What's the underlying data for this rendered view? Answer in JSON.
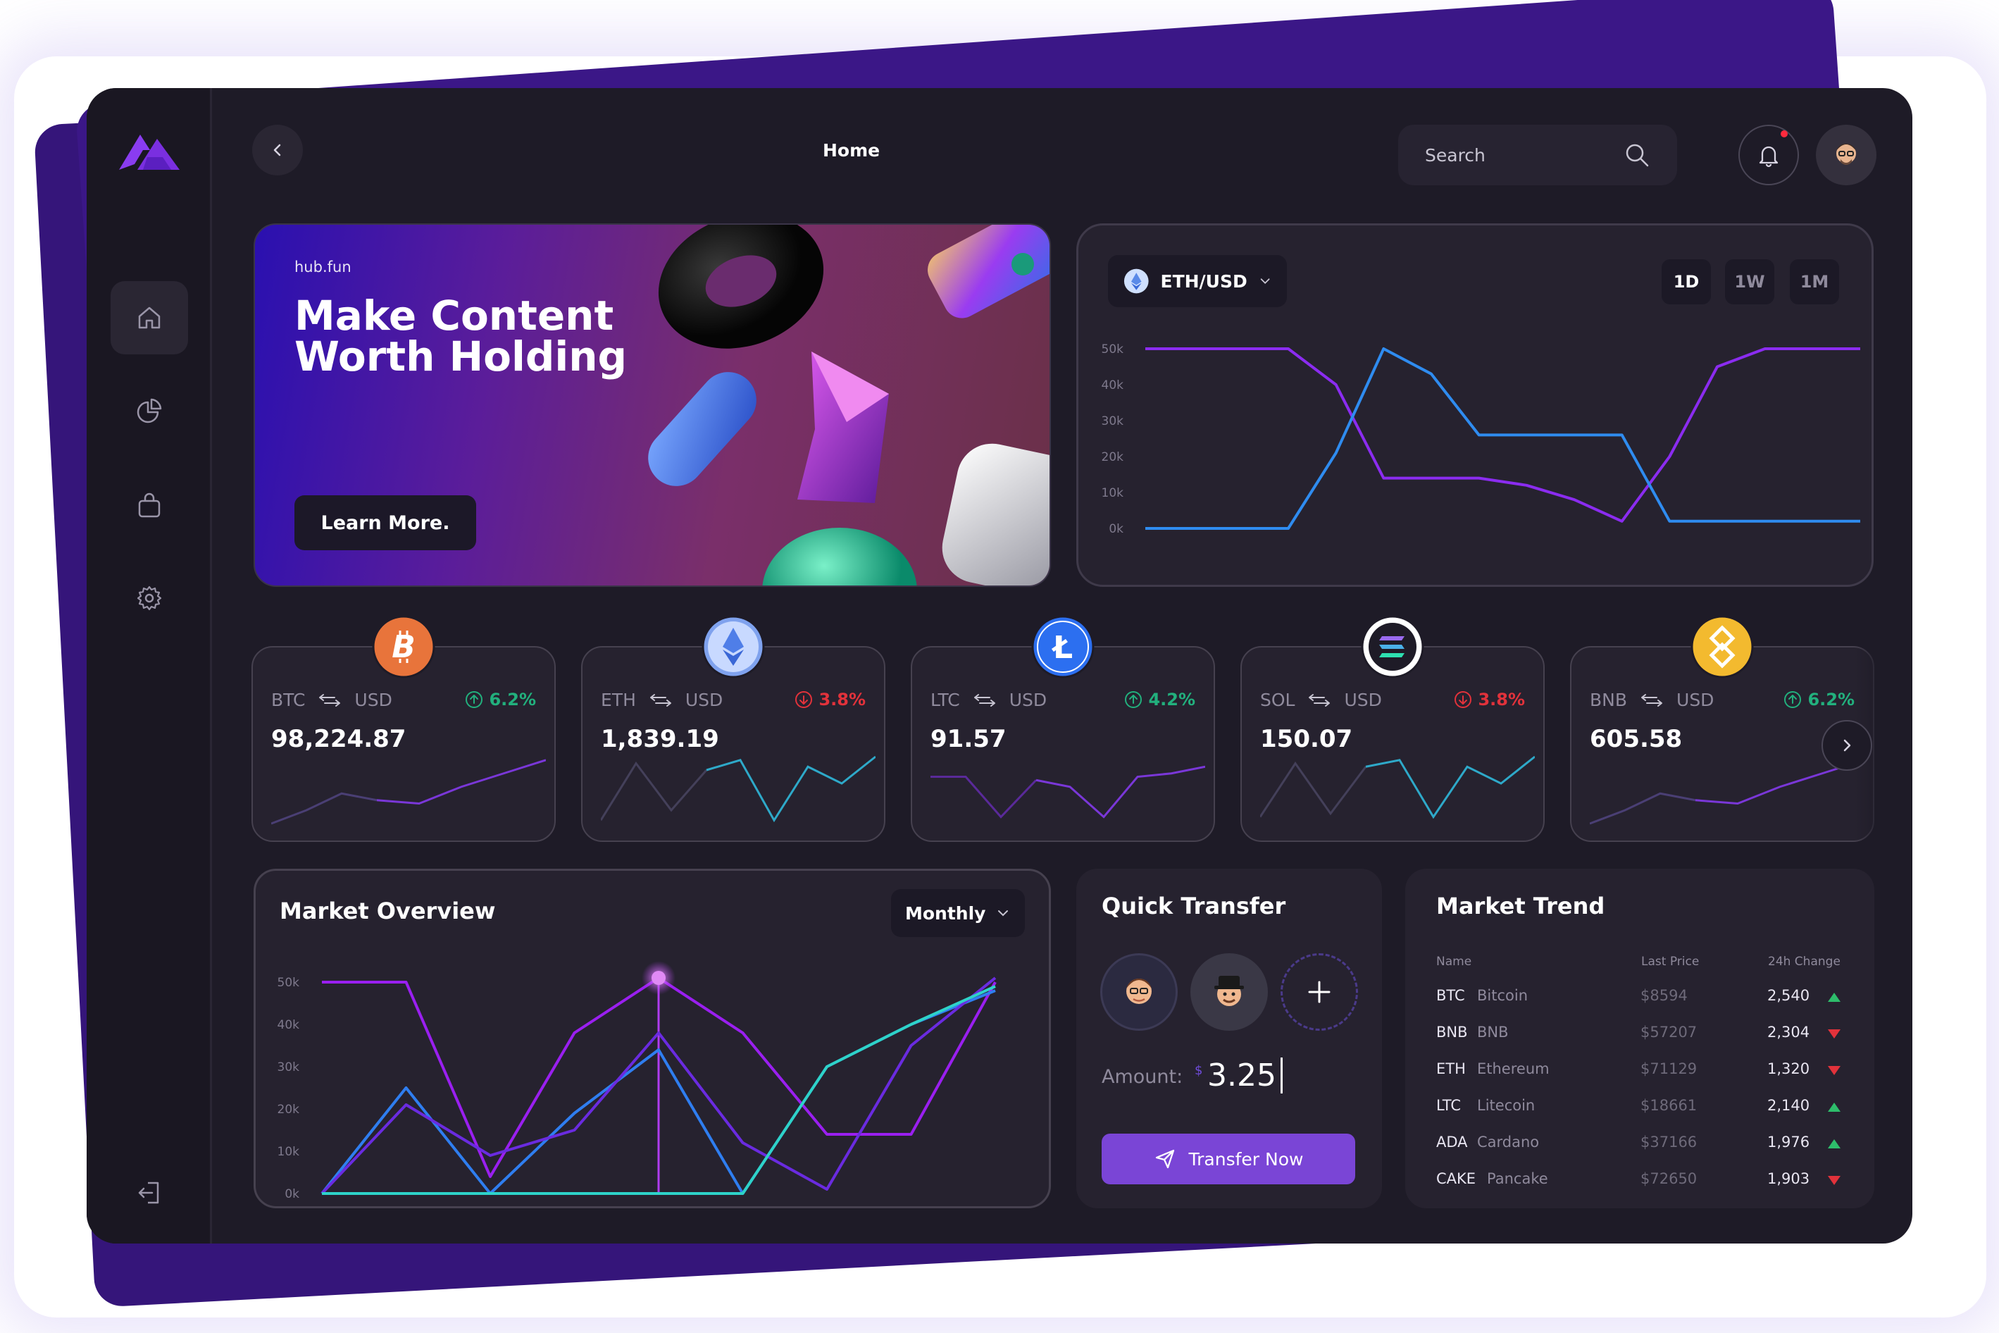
{
  "header": {
    "page_title": "Home",
    "search_placeholder": "Search"
  },
  "hero": {
    "brand": "hub.fun",
    "title": "Make Content Worth Holding",
    "cta_label": "Learn More."
  },
  "eth_chart": {
    "pair_label": "ETH/USD",
    "ranges": [
      "1D",
      "1W",
      "1M"
    ],
    "active_range": "1D"
  },
  "coins": [
    {
      "base": "BTC",
      "quote": "USD",
      "change": "6.2%",
      "direction": "up",
      "price": "98,224.87",
      "icon": "bitcoin-icon",
      "color": "#e8743b"
    },
    {
      "base": "ETH",
      "quote": "USD",
      "change": "3.8%",
      "direction": "down",
      "price": "1,839.19",
      "icon": "ethereum-icon",
      "color": "#7fa2ee"
    },
    {
      "base": "LTC",
      "quote": "USD",
      "change": "4.2%",
      "direction": "up",
      "price": "91.57",
      "icon": "litecoin-icon",
      "color": "#2c6ff0"
    },
    {
      "base": "SOL",
      "quote": "USD",
      "change": "3.8%",
      "direction": "down",
      "price": "150.07",
      "icon": "solana-icon",
      "color": "#ffffff"
    },
    {
      "base": "BNB",
      "quote": "USD",
      "change": "6.2%",
      "direction": "up",
      "price": "605.58",
      "icon": "bnb-icon",
      "color": "#f3ba2f"
    }
  ],
  "market_overview": {
    "title": "Market Overview",
    "period": "Monthly"
  },
  "quick_transfer": {
    "title": "Quick Transfer",
    "amount_label": "Amount:",
    "currency": "$",
    "amount": "3.25",
    "button_label": "Transfer Now"
  },
  "market_trend": {
    "title": "Market Trend",
    "columns": [
      "Name",
      "Last Price",
      "24h Change"
    ],
    "rows": [
      {
        "symbol": "BTC",
        "name": "Bitcoin",
        "last_price": "$8594",
        "change": "2,540",
        "direction": "up"
      },
      {
        "symbol": "BNB",
        "name": "BNB",
        "last_price": "$57207",
        "change": "2,304",
        "direction": "down"
      },
      {
        "symbol": "ETH",
        "name": "Ethereum",
        "last_price": "$71129",
        "change": "1,320",
        "direction": "down"
      },
      {
        "symbol": "LTC",
        "name": "Litecoin",
        "last_price": "$18661",
        "change": "2,140",
        "direction": "up"
      },
      {
        "symbol": "ADA",
        "name": "Cardano",
        "last_price": "$37166",
        "change": "1,976",
        "direction": "up"
      },
      {
        "symbol": "CAKE",
        "name": "Pancake",
        "last_price": "$72650",
        "change": "1,903",
        "direction": "down"
      }
    ]
  },
  "chart_data": [
    {
      "type": "line",
      "y_ticks": [
        "50k",
        "40k",
        "30k",
        "20k",
        "10k",
        "0k"
      ],
      "ylim": [
        0,
        50000
      ],
      "x": [
        0,
        1,
        2,
        3,
        4,
        5,
        6,
        7,
        8,
        9,
        10,
        11,
        12,
        13,
        14,
        15
      ],
      "series": [
        {
          "color": "#8b2cf0",
          "values": [
            50000,
            50000,
            50000,
            50000,
            40000,
            14000,
            14000,
            14000,
            12000,
            8000,
            2000,
            20000,
            45000,
            50000,
            50000,
            50000
          ]
        },
        {
          "color": "#2f8cf0",
          "values": [
            0,
            0,
            0,
            0,
            21000,
            50000,
            43000,
            26000,
            26000,
            26000,
            26000,
            2000,
            2000,
            2000,
            2000,
            2000
          ]
        }
      ]
    },
    {
      "type": "line",
      "y_ticks": [
        "50k",
        "40k",
        "30k",
        "20k",
        "10k",
        "0k"
      ],
      "ylim": [
        0,
        50000
      ],
      "series": [
        {
          "color": "#9a1ff0",
          "values": [
            50000,
            50000,
            4000,
            38000,
            51000,
            38000,
            14000,
            14000,
            50000
          ]
        },
        {
          "color": "#2f7ef0",
          "values": [
            0,
            25000,
            0,
            19000,
            34000,
            0,
            30000,
            40000,
            48000
          ]
        },
        {
          "color": "#6a2be0",
          "values": [
            0,
            21000,
            9000,
            15000,
            38000,
            12000,
            1000,
            35000,
            51000
          ]
        },
        {
          "color": "#2ed3c9",
          "values": [
            0,
            0,
            0,
            0,
            0,
            0,
            30000,
            40000,
            49000
          ]
        }
      ]
    }
  ]
}
